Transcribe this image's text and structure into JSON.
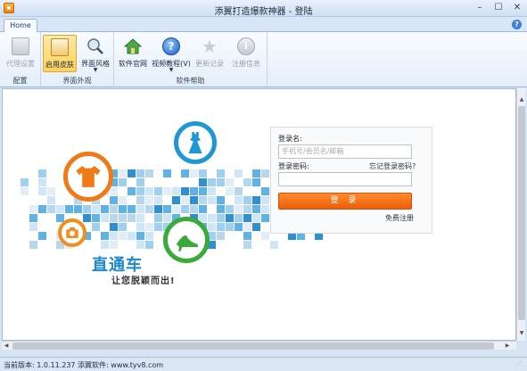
{
  "window": {
    "title": "添翼打造爆款神器 - 登陆",
    "minimize": "–",
    "maximize": "☐",
    "close": "✕"
  },
  "tabs": {
    "home": "Home",
    "help": "?"
  },
  "ribbon": {
    "groups": [
      {
        "label": "配置",
        "buttons": [
          {
            "label": "代理设置",
            "icon": "proxy-settings-icon",
            "state": "disabled"
          }
        ]
      },
      {
        "label": "界面外观",
        "buttons": [
          {
            "label": "启用皮肤",
            "icon": "skin-icon",
            "state": "active"
          },
          {
            "label": "界面风格",
            "icon": "style-icon",
            "state": "normal",
            "dropdown": "▼"
          }
        ]
      },
      {
        "label": "软件帮助",
        "buttons": [
          {
            "label": "软件官网",
            "icon": "home-icon",
            "state": "normal"
          },
          {
            "label": "视频教程(V)",
            "icon": "help-icon",
            "state": "normal",
            "dropdown": "▼"
          },
          {
            "label": "更新记录",
            "icon": "star-icon",
            "state": "disabled"
          },
          {
            "label": "注册信息",
            "icon": "info-icon",
            "state": "disabled"
          }
        ]
      }
    ]
  },
  "promo": {
    "brand": "直通车",
    "slogan": "让您脱颖而出!"
  },
  "login": {
    "username_label": "登录名:",
    "username_placeholder": "手机号/会员名/邮箱",
    "password_label": "登录密码:",
    "forgot_label": "忘记登录密码?",
    "submit_label": "登 录",
    "register_label": "免费注册"
  },
  "status": {
    "text": "当前版本: 1.0.11.237 添翼软件: www.tyv8.com"
  },
  "colors": {
    "accent": "#f07a17",
    "blue": "#1e97d4",
    "green": "#3aab3a",
    "login_button": "#f26d11"
  }
}
